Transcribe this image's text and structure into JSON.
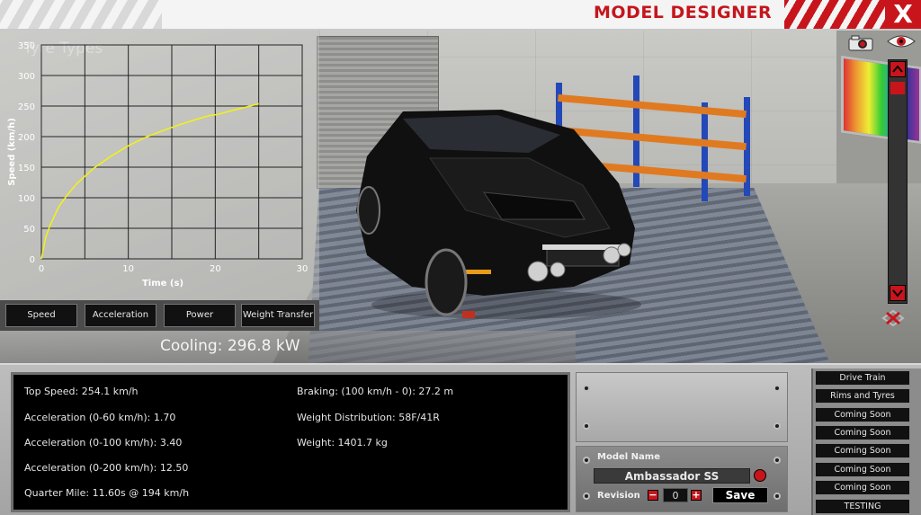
{
  "window": {
    "title": "MODEL DESIGNER",
    "close_label": "X",
    "accent": "#c8151c"
  },
  "chart": {
    "watermark": "Tyre Types"
  },
  "chart_data": {
    "type": "line",
    "title": "",
    "xlabel": "Time (s)",
    "ylabel": "Speed (km/h)",
    "xlim": [
      0,
      30
    ],
    "ylim": [
      0,
      350
    ],
    "xticks": [
      0,
      10,
      20,
      30
    ],
    "yticks": [
      0,
      50,
      100,
      150,
      200,
      250,
      300,
      350
    ],
    "grid": true,
    "series": [
      {
        "color": "#f2f01a",
        "x": [
          0,
          0.5,
          1,
          2,
          3,
          4,
          5,
          6,
          8,
          10,
          12,
          14,
          16,
          18,
          19.5,
          20.2,
          22,
          24,
          25
        ],
        "y": [
          0,
          35,
          55,
          85,
          105,
          122,
          135,
          148,
          168,
          185,
          199,
          210,
          220,
          229,
          235,
          236,
          243,
          250,
          254
        ]
      }
    ]
  },
  "chart_tabs": [
    "Speed",
    "Acceleration",
    "Power",
    "Weight Transfer"
  ],
  "cooling": {
    "text": "Cooling: 296.8 kW"
  },
  "stats": {
    "left": [
      "Top Speed: 254.1 km/h",
      "Acceleration (0-60 km/h): 1.70",
      "Acceleration (0-100 km/h): 3.40",
      "Acceleration (0-200 km/h): 12.50",
      "Quarter Mile: 11.60s @ 194 km/h"
    ],
    "right": [
      "Braking: (100 km/h - 0): 27.2 m",
      "Weight Distribution: 58F/41R",
      "Weight: 1401.7 kg"
    ]
  },
  "model": {
    "name_label": "Model Name",
    "name_value": "Ambassador SS",
    "revision_label": "Revision",
    "revision_value": "0",
    "minus": "−",
    "plus": "+",
    "save_label": "Save"
  },
  "side_menu": [
    "Drive Train",
    "Rims and Tyres",
    "Coming Soon",
    "Coming Soon",
    "Coming Soon",
    "Coming Soon",
    "Coming Soon",
    "TESTING"
  ],
  "icons": {
    "camera": "camera-icon",
    "eye": "eye-icon",
    "scroll_up": "chevron-up-icon",
    "scroll_down": "chevron-down-icon",
    "reset": "reset-view-icon"
  }
}
